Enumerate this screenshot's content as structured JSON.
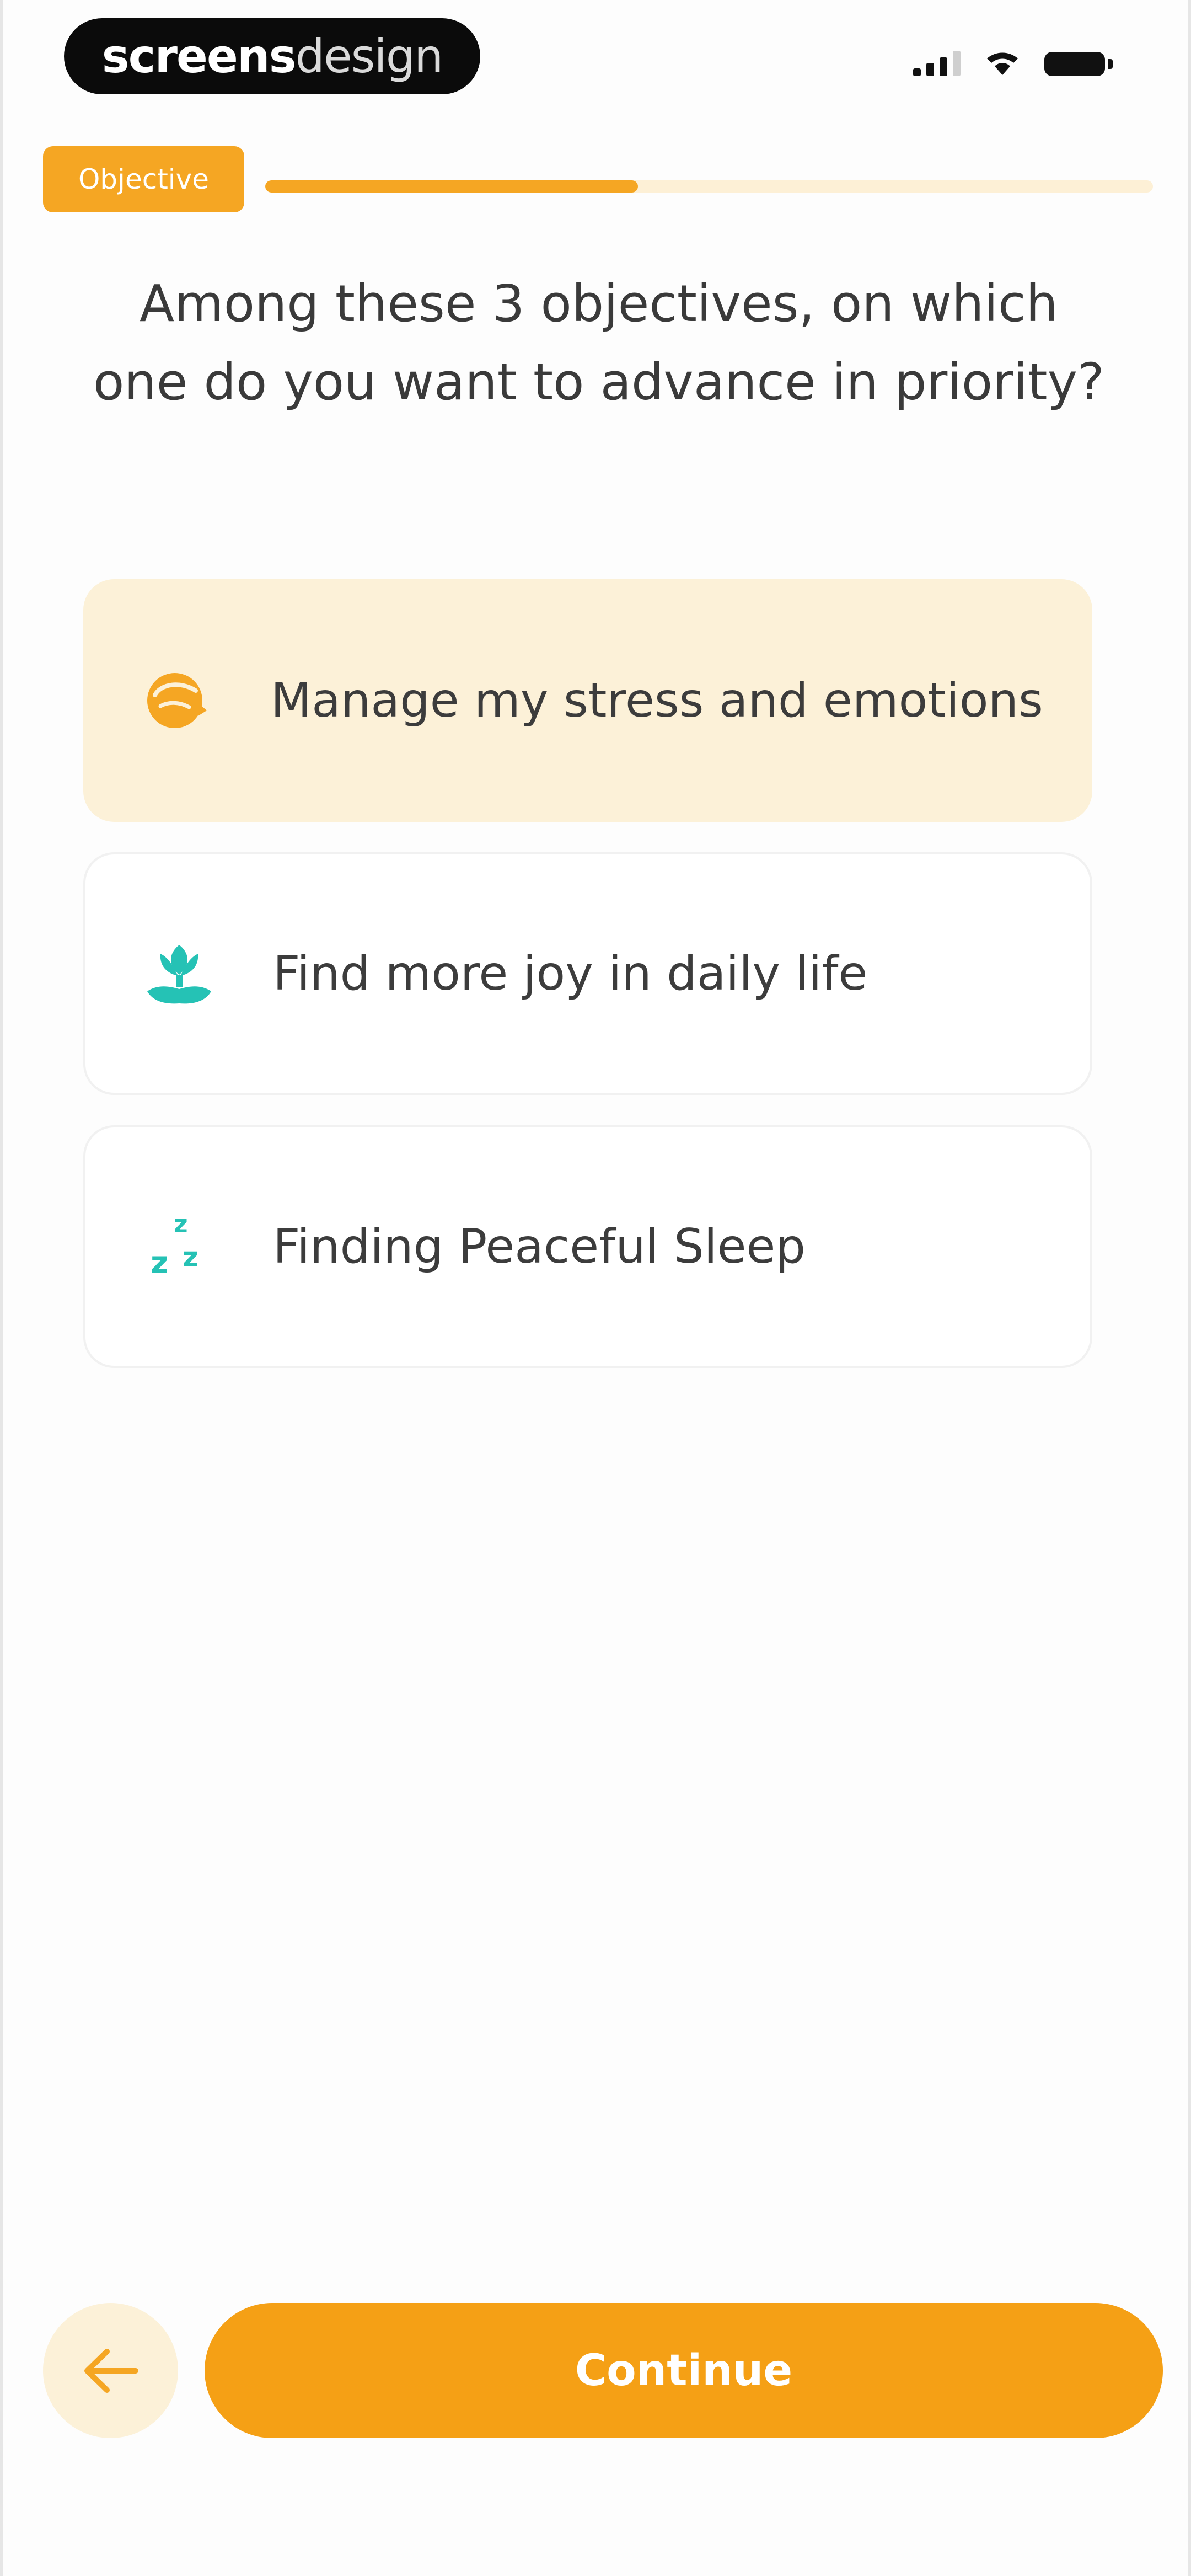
{
  "status_bar": {
    "brand_bold": "screens",
    "brand_light": "design",
    "icons": [
      "signal-icon",
      "wifi-icon",
      "battery-icon"
    ]
  },
  "progress": {
    "step_label": "Objective",
    "fraction": 0.42
  },
  "question": "Among these 3 objectives, on which one do you want to advance in priority?",
  "options": [
    {
      "label": "Manage my stress and emotions",
      "icon": "stress-head-icon",
      "selected": true
    },
    {
      "label": "Find more joy in daily life",
      "icon": "lotus-hand-icon",
      "selected": false
    },
    {
      "label": "Finding Peaceful Sleep",
      "icon": "sleep-zzz-icon",
      "selected": false
    }
  ],
  "footer": {
    "continue_label": "Continue",
    "back_icon": "arrow-left-icon"
  },
  "colors": {
    "accent": "#f5a623",
    "accent_light": "#fcf1d8",
    "teal_icon": "#25c2b5"
  }
}
